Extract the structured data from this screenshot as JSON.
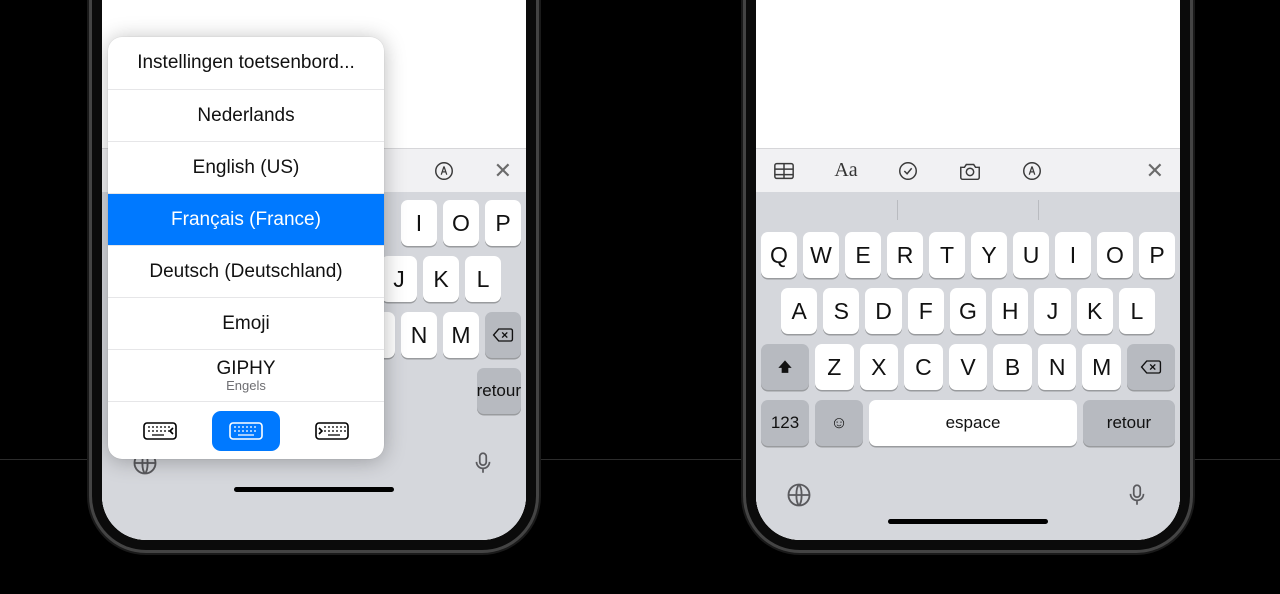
{
  "popup": {
    "title": "Instellingen toetsenbord...",
    "items": [
      {
        "label": "Nederlands"
      },
      {
        "label": "English (US)"
      },
      {
        "label": "Français (France)",
        "selected": true
      },
      {
        "label": "Deutsch (Deutschland)"
      },
      {
        "label": "Emoji"
      },
      {
        "label": "GIPHY",
        "sub": "Engels"
      }
    ]
  },
  "keyboard": {
    "row1": [
      "Q",
      "W",
      "E",
      "R",
      "T",
      "Y",
      "U",
      "I",
      "O",
      "P"
    ],
    "row2": [
      "A",
      "S",
      "D",
      "F",
      "G",
      "H",
      "J",
      "K",
      "L"
    ],
    "row3": [
      "Z",
      "X",
      "C",
      "V",
      "B",
      "N",
      "M"
    ],
    "num_key": "123",
    "space": "espace",
    "return": "retour"
  }
}
